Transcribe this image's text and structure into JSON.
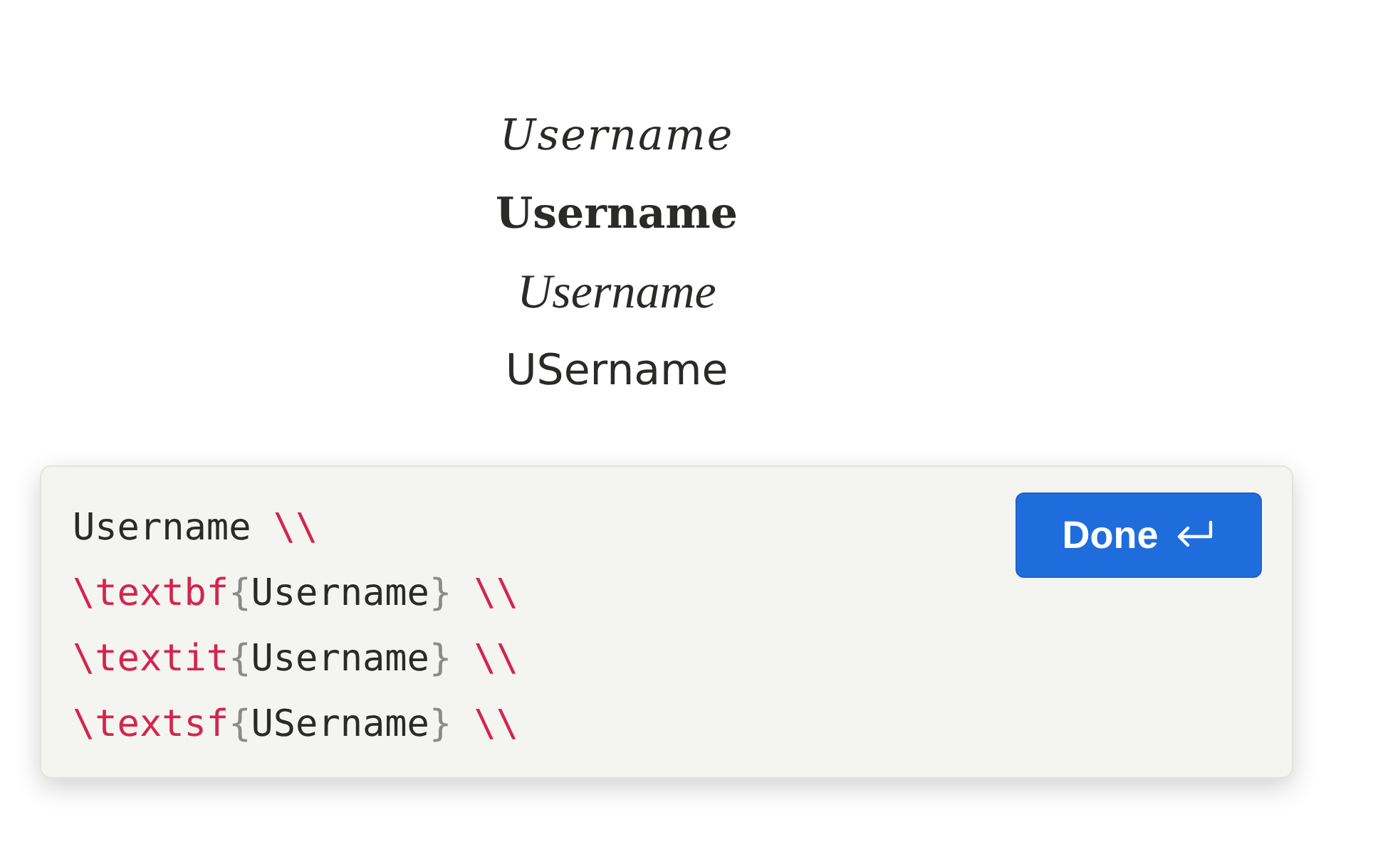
{
  "rendered_lines": [
    {
      "kind": "math-italic",
      "text": "Username"
    },
    {
      "kind": "bold",
      "text": "Username"
    },
    {
      "kind": "italic",
      "text": "Username"
    },
    {
      "kind": "sans",
      "text": "USername"
    }
  ],
  "editor": {
    "code_lines": [
      [
        {
          "kind": "text",
          "text": "Username"
        },
        {
          "kind": "newline",
          "text": "\\\\"
        }
      ],
      [
        {
          "kind": "command",
          "text": "\\textbf"
        },
        {
          "kind": "brace",
          "text": "{"
        },
        {
          "kind": "text",
          "text": "Username"
        },
        {
          "kind": "brace",
          "text": "}"
        },
        {
          "kind": "newline",
          "text": "\\\\"
        }
      ],
      [
        {
          "kind": "command",
          "text": "\\textit"
        },
        {
          "kind": "brace",
          "text": "{"
        },
        {
          "kind": "text",
          "text": "Username"
        },
        {
          "kind": "brace",
          "text": "}"
        },
        {
          "kind": "newline",
          "text": "\\\\"
        }
      ],
      [
        {
          "kind": "command",
          "text": "\\textsf"
        },
        {
          "kind": "brace",
          "text": "{"
        },
        {
          "kind": "text",
          "text": "USername"
        },
        {
          "kind": "brace",
          "text": "}"
        },
        {
          "kind": "newline",
          "text": "\\\\"
        }
      ]
    ],
    "done_button": {
      "label": "Done"
    }
  }
}
